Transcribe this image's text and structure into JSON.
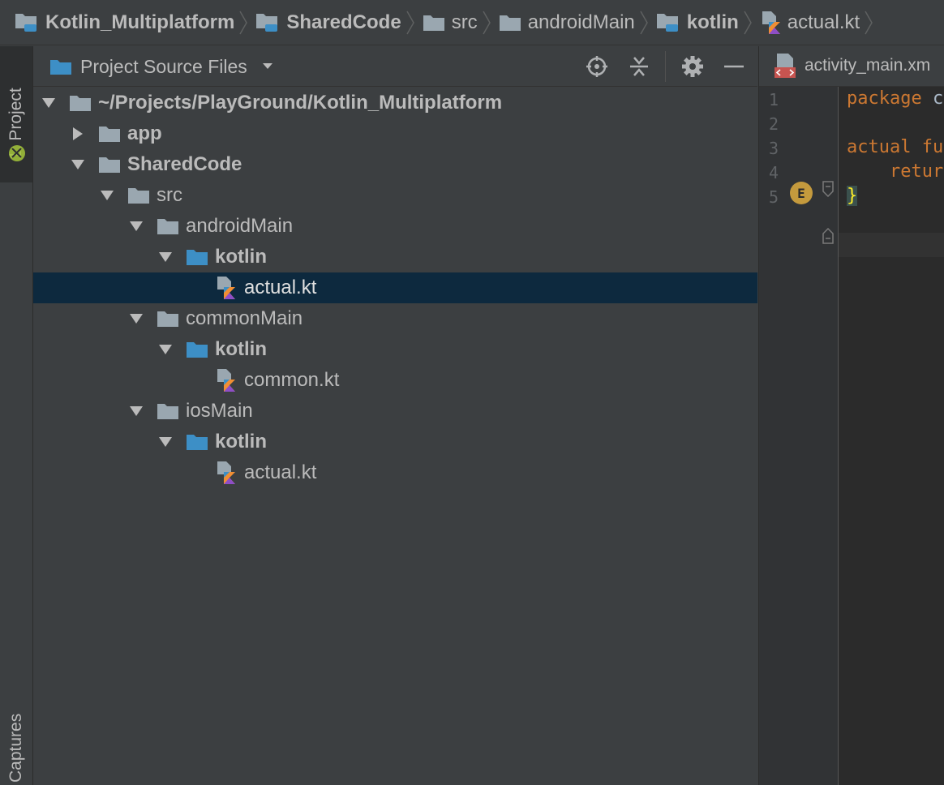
{
  "breadcrumb": {
    "items": [
      {
        "label": "Kotlin_Multiplatform",
        "icon": "module-folder-icon",
        "bold": true
      },
      {
        "label": "SharedCode",
        "icon": "module-folder-icon",
        "bold": true
      },
      {
        "label": "src",
        "icon": "folder-icon",
        "bold": false
      },
      {
        "label": "androidMain",
        "icon": "folder-icon",
        "bold": false
      },
      {
        "label": "kotlin",
        "icon": "module-folder-icon",
        "bold": true
      },
      {
        "label": "actual.kt",
        "icon": "kotlin-file-icon",
        "bold": false
      }
    ]
  },
  "tool_stripe": {
    "project_tab": "1: Project",
    "captures_tab": "Captures"
  },
  "panel": {
    "view_label": "Project Source Files",
    "tree": [
      {
        "label": "~/Projects/PlayGround/Kotlin_Multiplatform",
        "icon": "folder-icon",
        "expanded": true,
        "bold": true,
        "selected": false
      },
      {
        "label": "app",
        "icon": "folder-icon",
        "expanded": false,
        "bold": true,
        "selected": false
      },
      {
        "label": "SharedCode",
        "icon": "folder-icon",
        "expanded": true,
        "bold": true,
        "selected": false
      },
      {
        "label": "src",
        "icon": "folder-icon",
        "expanded": true,
        "bold": false,
        "selected": false
      },
      {
        "label": "androidMain",
        "icon": "folder-icon",
        "expanded": true,
        "bold": false,
        "selected": false
      },
      {
        "label": "kotlin",
        "icon": "source-folder-icon",
        "expanded": true,
        "bold": true,
        "selected": false
      },
      {
        "label": "actual.kt",
        "icon": "kotlin-file-icon",
        "expanded": null,
        "bold": false,
        "selected": true
      },
      {
        "label": "commonMain",
        "icon": "folder-icon",
        "expanded": true,
        "bold": false,
        "selected": false
      },
      {
        "label": "kotlin",
        "icon": "source-folder-icon",
        "expanded": true,
        "bold": true,
        "selected": false
      },
      {
        "label": "common.kt",
        "icon": "kotlin-file-icon",
        "expanded": null,
        "bold": false,
        "selected": false
      },
      {
        "label": "iosMain",
        "icon": "folder-icon",
        "expanded": true,
        "bold": false,
        "selected": false
      },
      {
        "label": "kotlin",
        "icon": "source-folder-icon",
        "expanded": true,
        "bold": true,
        "selected": false
      },
      {
        "label": "actual.kt",
        "icon": "kotlin-file-icon",
        "expanded": null,
        "bold": false,
        "selected": false
      }
    ]
  },
  "editor": {
    "tab_label": "activity_main.xm",
    "line_numbers": [
      "1",
      "2",
      "3",
      "4",
      "5"
    ],
    "lines": [
      {
        "kw": "package ",
        "rest": "c"
      },
      {
        "kw": "",
        "rest": ""
      },
      {
        "kw": "actual fu",
        "rest": ""
      },
      {
        "kw": "    retur",
        "rest": ""
      },
      {
        "kw": "",
        "rest": "}"
      }
    ],
    "gutter_marker": "E"
  },
  "colors": {
    "background": "#3c3f41",
    "editor_bg": "#2b2b2b",
    "selection": "#0d293e",
    "keyword": "#cc7832",
    "folder": "#9aa7b0",
    "source_folder": "#3d8fc6"
  }
}
